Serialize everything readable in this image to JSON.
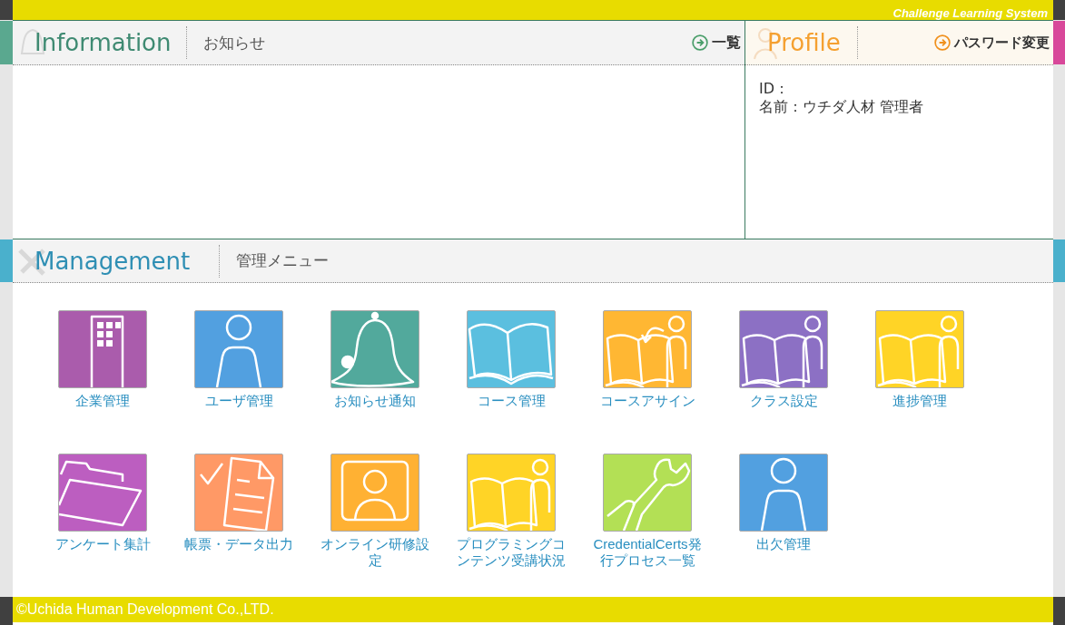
{
  "header": {
    "system_name": "Challenge Learning System"
  },
  "information": {
    "title": "Information",
    "subtitle": "お知らせ",
    "link": "一覧"
  },
  "profile": {
    "title": "Profile",
    "link": "パスワード変更",
    "lines": [
      "ID：",
      "名前：ウチダ人材 管理者"
    ]
  },
  "management": {
    "title": "Management",
    "subtitle": "管理メニュー",
    "items": [
      {
        "label": "企業管理",
        "kind": "building",
        "color": "#aa5cac"
      },
      {
        "label": "ユーザ管理",
        "kind": "person",
        "color": "#52a0e0"
      },
      {
        "label": "お知らせ通知",
        "kind": "bell",
        "color": "#52a99c"
      },
      {
        "label": "コース管理",
        "kind": "book",
        "color": "#5bbfdf"
      },
      {
        "label": "コースアサイン",
        "kind": "book-assign",
        "color": "#ffb733"
      },
      {
        "label": "クラス設定",
        "kind": "book-person",
        "color": "#8c70c4"
      },
      {
        "label": "進捗管理",
        "kind": "book-person",
        "color": "#ffd426"
      },
      {
        "label": "アンケート集計",
        "kind": "folder",
        "color": "#bc5ec0"
      },
      {
        "label": "帳票・データ出力",
        "kind": "document",
        "color": "#ff9966"
      },
      {
        "label": "オンライン研修設定",
        "kind": "portrait",
        "color": "#ffb133"
      },
      {
        "label": "プログラミングコンテンツ受講状況",
        "kind": "book-person",
        "color": "#ffd426"
      },
      {
        "label": "CredentialCerts発行プロセス一覧",
        "kind": "wrench",
        "color": "#b3e055"
      },
      {
        "label": "出欠管理",
        "kind": "person",
        "color": "#52a0e0"
      }
    ]
  },
  "footer": {
    "copyright": "©Uchida Human Development Co.,LTD."
  }
}
